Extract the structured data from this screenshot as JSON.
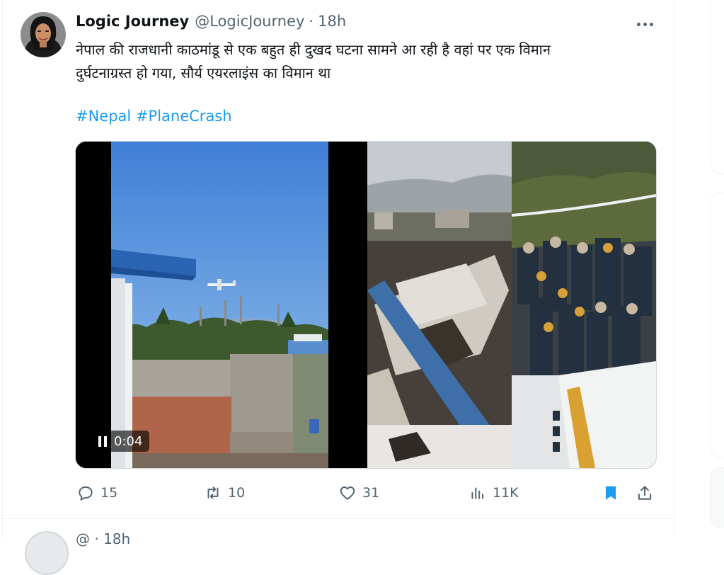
{
  "tweet": {
    "author": {
      "display_name": "Logic Journey",
      "handle": "@LogicJourney",
      "separator": "·",
      "time": "18h"
    },
    "text_lines": [
      "नेपाल की राजधानी काठमांडू से एक बहुत ही दुखद घटना सामने आ रही है वहां पर  एक विमान",
      "दुर्घटनाग्रस्त हो गया, सौर्य एयरलाइंस का विमान था"
    ],
    "hashtags": [
      "#Nepal",
      "#PlaneCrash"
    ],
    "media": {
      "video_time": "0:04",
      "playback_state": "playing"
    },
    "actions": {
      "replies": "15",
      "reposts": "10",
      "likes": "31",
      "views": "11K",
      "bookmarked": true
    }
  },
  "next_tweet": {
    "handle_fragment": "@",
    "separator": "·",
    "time": "18h"
  },
  "colors": {
    "accent": "#1d9bf0",
    "text": "#0f1419",
    "muted": "#536471",
    "border": "#eff3f4"
  },
  "icons": [
    "more-icon",
    "pause-icon",
    "reply-icon",
    "repost-icon",
    "like-icon",
    "views-icon",
    "bookmark-icon",
    "share-icon"
  ]
}
